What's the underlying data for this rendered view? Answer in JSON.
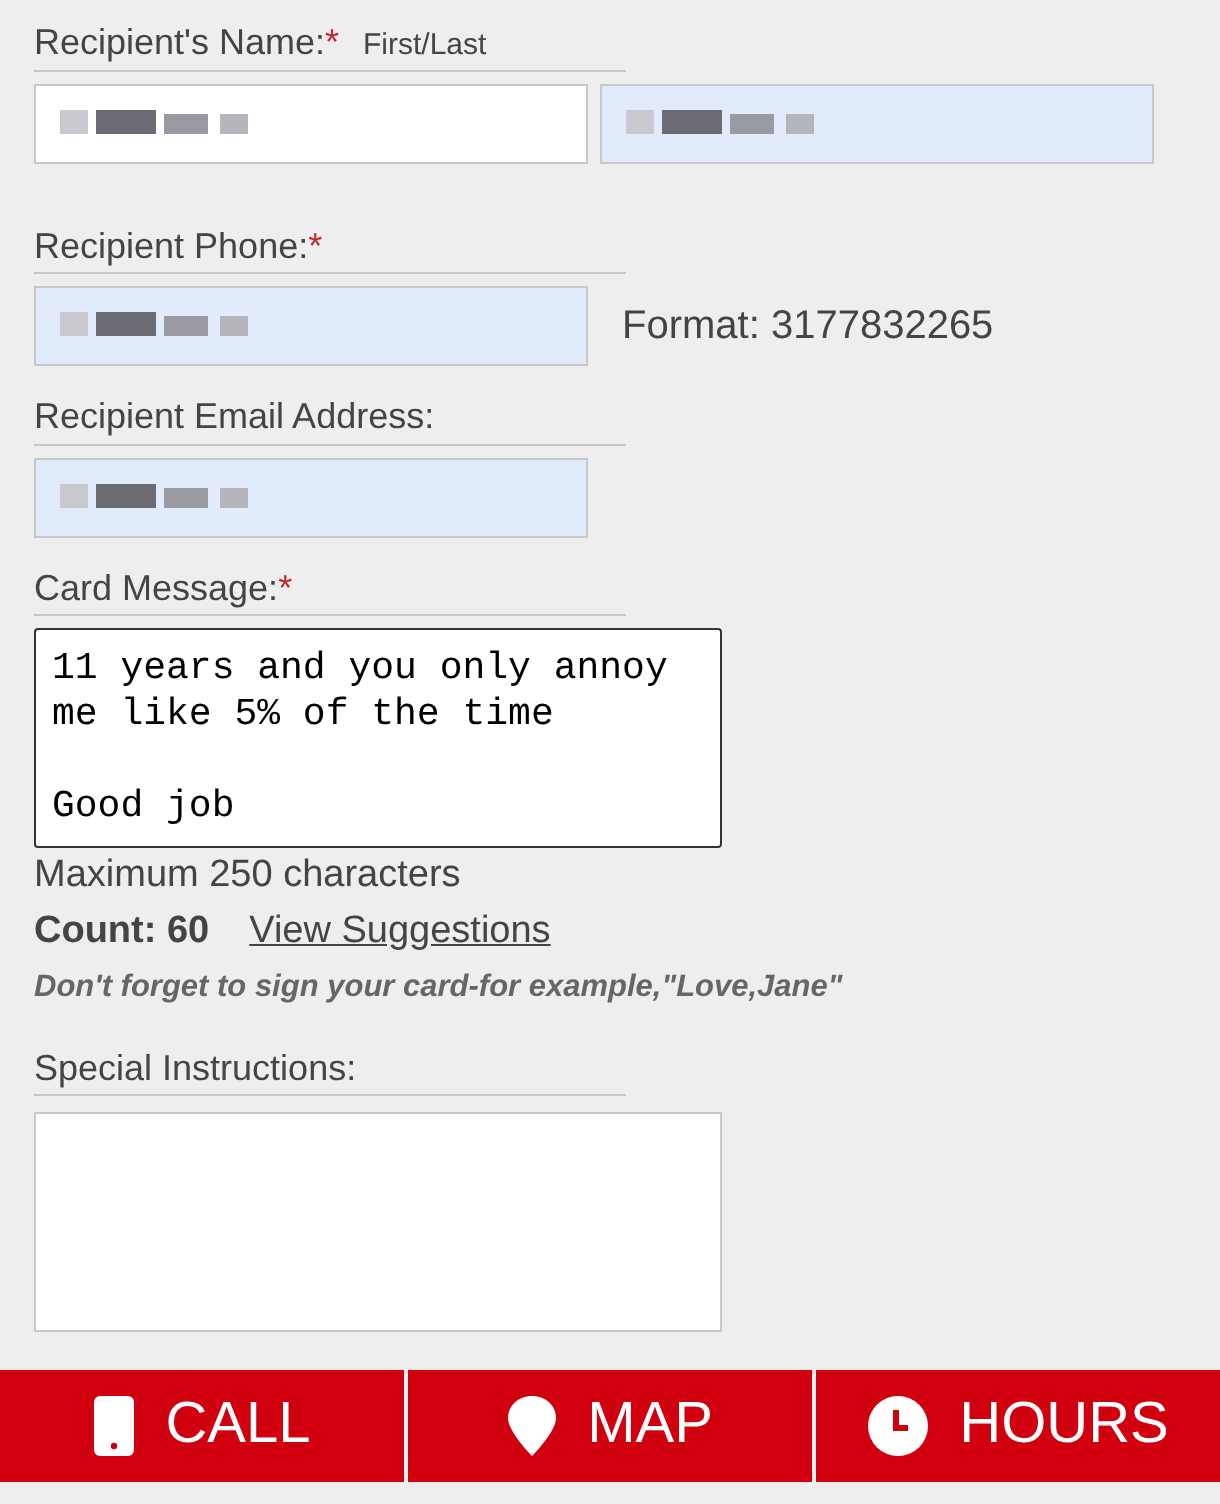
{
  "recipient_name": {
    "label": "Recipient's Name:",
    "required_mark": "*",
    "hint": "First/Last",
    "fields": [
      {
        "autofilled": false,
        "redacted": true
      },
      {
        "autofilled": true,
        "redacted": true
      }
    ]
  },
  "recipient_phone": {
    "label": "Recipient Phone:",
    "required_mark": "*",
    "field": {
      "autofilled": true,
      "redacted": true
    },
    "format_note": "Format: 3177832265"
  },
  "recipient_email": {
    "label": "Recipient Email Address:",
    "field": {
      "autofilled": true,
      "redacted": true
    }
  },
  "card_message": {
    "label": "Card Message:",
    "required_mark": "*",
    "value": "11 years and you only annoy\nme like 5% of the time\n\nGood job",
    "max_note": "Maximum 250 characters",
    "count": "Count: 60",
    "suggestions_link": "View Suggestions",
    "tip": "Don't forget to sign your card-for example,\"Love,Jane\""
  },
  "special_instructions": {
    "label": "Special Instructions:"
  },
  "action_bar": [
    {
      "kind": "phone",
      "label": "CALL"
    },
    {
      "kind": "pin",
      "label": "MAP"
    },
    {
      "kind": "clock",
      "label": "HOURS"
    }
  ]
}
